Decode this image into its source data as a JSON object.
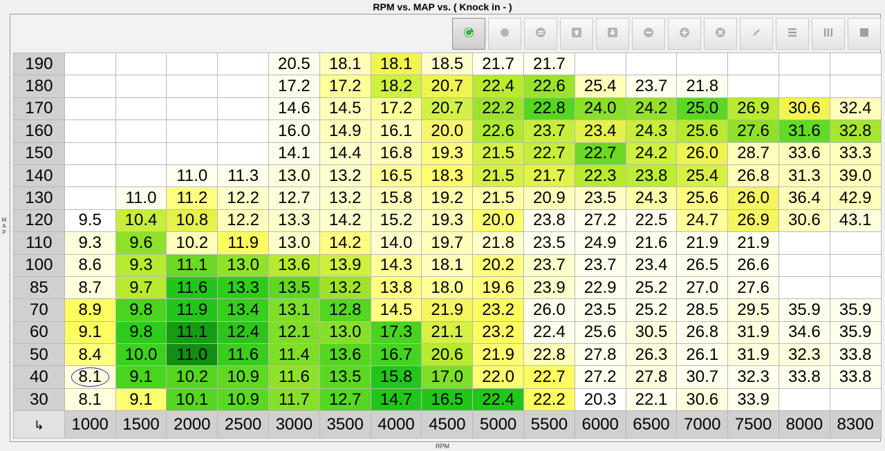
{
  "window": {
    "title": "RPM vs. MAP vs. ( Knock in -   )"
  },
  "axes": {
    "y_label": "MAP",
    "x_label": "RPM"
  },
  "toolbar": {
    "buttons": [
      {
        "icon": "refresh-icon",
        "active": true
      },
      {
        "icon": "circle-icon"
      },
      {
        "icon": "equals-icon"
      },
      {
        "icon": "arrow-up-icon"
      },
      {
        "icon": "arrow-down-icon"
      },
      {
        "icon": "minus-icon"
      },
      {
        "icon": "plus-icon"
      },
      {
        "icon": "close-icon"
      },
      {
        "icon": "pencil-icon"
      },
      {
        "icon": "rows-icon"
      },
      {
        "icon": "columns-icon"
      },
      {
        "icon": "square-icon"
      }
    ]
  },
  "table": {
    "corner_glyph": "↳",
    "rpm": [
      "1000",
      "1500",
      "2000",
      "2500",
      "3000",
      "3500",
      "4000",
      "4500",
      "5000",
      "5500",
      "6000",
      "6500",
      "7000",
      "7500",
      "8000",
      "8300"
    ],
    "rows": [
      {
        "map": "190",
        "cells": [
          "",
          "",
          "",
          "",
          "20.5",
          "18.1",
          "18.1",
          "18.5",
          "21.7",
          "21.7",
          "",
          "",
          "",
          "",
          "",
          ""
        ]
      },
      {
        "map": "180",
        "cells": [
          "",
          "",
          "",
          "",
          "17.2",
          "17.2",
          "18.2",
          "20.7",
          "22.4",
          "22.6",
          "25.4",
          "23.7",
          "21.8",
          "",
          "",
          ""
        ]
      },
      {
        "map": "170",
        "cells": [
          "",
          "",
          "",
          "",
          "14.6",
          "14.5",
          "17.2",
          "20.7",
          "22.2",
          "22.8",
          "24.0",
          "24.2",
          "25.0",
          "26.9",
          "30.6",
          "32.4"
        ]
      },
      {
        "map": "160",
        "cells": [
          "",
          "",
          "",
          "",
          "16.0",
          "14.9",
          "16.1",
          "20.0",
          "22.6",
          "23.7",
          "23.4",
          "24.3",
          "25.6",
          "27.6",
          "31.6",
          "32.8"
        ]
      },
      {
        "map": "150",
        "cells": [
          "",
          "",
          "",
          "",
          "14.1",
          "14.4",
          "16.8",
          "19.3",
          "21.5",
          "22.7",
          "22.7",
          "24.2",
          "26.0",
          "28.7",
          "33.6",
          "33.3"
        ]
      },
      {
        "map": "140",
        "cells": [
          "",
          "",
          "11.0",
          "11.3",
          "13.0",
          "13.2",
          "16.5",
          "18.3",
          "21.5",
          "21.7",
          "22.3",
          "23.8",
          "25.4",
          "26.8",
          "31.3",
          "39.0"
        ]
      },
      {
        "map": "130",
        "cells": [
          "",
          "11.0",
          "11.2",
          "12.2",
          "12.7",
          "13.2",
          "15.8",
          "19.2",
          "21.5",
          "20.9",
          "23.5",
          "24.3",
          "25.6",
          "26.0",
          "36.4",
          "42.9"
        ]
      },
      {
        "map": "120",
        "cells": [
          "9.5",
          "10.4",
          "10.8",
          "12.2",
          "13.3",
          "14.2",
          "15.2",
          "19.3",
          "20.0",
          "23.8",
          "27.2",
          "22.5",
          "24.7",
          "26.9",
          "30.6",
          "43.1"
        ]
      },
      {
        "map": "110",
        "cells": [
          "9.3",
          "9.6",
          "10.2",
          "11.9",
          "13.0",
          "14.2",
          "14.0",
          "19.7",
          "21.8",
          "23.5",
          "24.9",
          "21.6",
          "21.9",
          "21.9",
          "",
          ""
        ]
      },
      {
        "map": "100",
        "cells": [
          "8.6",
          "9.3",
          "11.1",
          "13.0",
          "13.6",
          "13.9",
          "14.3",
          "18.1",
          "20.2",
          "23.7",
          "23.7",
          "23.4",
          "26.5",
          "26.6",
          "",
          ""
        ]
      },
      {
        "map": "85",
        "cells": [
          "8.7",
          "9.7",
          "11.6",
          "13.3",
          "13.5",
          "13.2",
          "13.8",
          "18.0",
          "19.6",
          "23.9",
          "22.9",
          "25.2",
          "27.0",
          "27.6",
          "",
          ""
        ]
      },
      {
        "map": "70",
        "cells": [
          "8.9",
          "9.8",
          "11.9",
          "13.4",
          "13.1",
          "12.8",
          "14.5",
          "21.9",
          "23.2",
          "26.0",
          "23.5",
          "25.2",
          "28.5",
          "29.5",
          "35.9",
          "35.9"
        ]
      },
      {
        "map": "60",
        "cells": [
          "9.1",
          "9.8",
          "11.1",
          "12.4",
          "12.1",
          "13.0",
          "17.3",
          "21.1",
          "23.2",
          "22.4",
          "25.6",
          "30.5",
          "26.8",
          "31.9",
          "34.6",
          "35.9"
        ]
      },
      {
        "map": "50",
        "cells": [
          "8.4",
          "10.0",
          "11.0",
          "11.6",
          "11.4",
          "13.6",
          "16.7",
          "20.6",
          "21.9",
          "22.8",
          "27.8",
          "26.3",
          "26.1",
          "31.9",
          "32.3",
          "33.8"
        ]
      },
      {
        "map": "40",
        "cells": [
          "8.1",
          "9.1",
          "10.2",
          "10.9",
          "11.6",
          "13.5",
          "15.8",
          "17.0",
          "22.0",
          "22.7",
          "27.2",
          "27.8",
          "30.7",
          "32.3",
          "33.8",
          "33.8"
        ]
      },
      {
        "map": "30",
        "cells": [
          "8.1",
          "9.1",
          "10.1",
          "10.9",
          "11.7",
          "12.7",
          "14.7",
          "16.5",
          "22.4",
          "22.2",
          "20.3",
          "22.1",
          "30.6",
          "33.9",
          "",
          ""
        ]
      }
    ],
    "colors": [
      [
        "#ffffff",
        "#ffffff",
        "#ffffff",
        "#ffffff",
        "#ffffee",
        "#ffffbb",
        "#f0f550",
        "#ffffcc",
        "#ffffee",
        "#ffffee",
        "#ffffff",
        "#ffffff",
        "#ffffff",
        "#ffffff",
        "#ffffff",
        "#ffffff"
      ],
      [
        "#ffffff",
        "#ffffff",
        "#ffffff",
        "#ffffff",
        "#ffffee",
        "#ffff99",
        "#cef040",
        "#eef550",
        "#b8ea30",
        "#9be22a",
        "#ffffbb",
        "#ffffee",
        "#ffffee",
        "#ffffff",
        "#ffffff",
        "#ffffff"
      ],
      [
        "#ffffff",
        "#ffffff",
        "#ffffff",
        "#ffffff",
        "#ffffee",
        "#ffffbb",
        "#ffff99",
        "#d2f045",
        "#9fe22c",
        "#55d620",
        "#88e028",
        "#95e02a",
        "#5ad822",
        "#b8ea30",
        "#f2f550",
        "#ffffbb"
      ],
      [
        "#ffffff",
        "#ffffff",
        "#ffffff",
        "#ffffff",
        "#ffffee",
        "#ffffbb",
        "#ffffbb",
        "#f7f570",
        "#b0ea30",
        "#c6ee3a",
        "#e2f24a",
        "#c6ee3a",
        "#b8ea30",
        "#90e02a",
        "#65da24",
        "#a5e62e"
      ],
      [
        "#ffffff",
        "#ffffff",
        "#ffffff",
        "#ffffff",
        "#ffffee",
        "#ffffcc",
        "#ffffbb",
        "#fdfd80",
        "#d6f045",
        "#c6ee3a",
        "#6ad824",
        "#cef040",
        "#eef550",
        "#ffffbb",
        "#ffffbb",
        "#ffffbb"
      ],
      [
        "#ffffff",
        "#ffffff",
        "#ffffee",
        "#ffffee",
        "#ffffdd",
        "#ffffcc",
        "#ffff99",
        "#fdfd70",
        "#d6f045",
        "#e2f24a",
        "#b8ea30",
        "#bcec34",
        "#d6f045",
        "#ffffbb",
        "#ffffbb",
        "#ffffbb"
      ],
      [
        "#ffffff",
        "#ffffee",
        "#ffff80",
        "#ffffcc",
        "#ffffdd",
        "#ffffcc",
        "#ffffbb",
        "#ffffaa",
        "#ffffaa",
        "#ffffbb",
        "#ffffcc",
        "#ffffaa",
        "#fdfd80",
        "#f5f560",
        "#ffffbb",
        "#ffffbb"
      ],
      [
        "#ffffff",
        "#c6ee3a",
        "#e6f24a",
        "#ffffbb",
        "#ffffcc",
        "#ffffcc",
        "#ffffcc",
        "#ffffbb",
        "#fdfd70",
        "#ffffee",
        "#ffffee",
        "#ffffee",
        "#ffff99",
        "#f5f560",
        "#ffffbb",
        "#ffffdd"
      ],
      [
        "#ffffdd",
        "#90e02a",
        "#ffffbb",
        "#fdfd60",
        "#ffffcc",
        "#fdfd80",
        "#ffffcc",
        "#ffffbb",
        "#ffffcc",
        "#ffffee",
        "#ffffee",
        "#ffffee",
        "#ffffee",
        "#ffffee",
        "#ffffff",
        "#ffffff"
      ],
      [
        "#ffffdd",
        "#b8ea30",
        "#6ad824",
        "#8ee22a",
        "#b8ea30",
        "#cef040",
        "#ffff99",
        "#ffffbb",
        "#fdfd80",
        "#ffffcc",
        "#ffffee",
        "#ffffee",
        "#ffffee",
        "#ffffee",
        "#ffffff",
        "#ffffff"
      ],
      [
        "#ffffdd",
        "#b8ea30",
        "#22c61a",
        "#30cc1c",
        "#60d822",
        "#9fe22c",
        "#ffff80",
        "#ffff99",
        "#ffff80",
        "#ffffcc",
        "#ffffee",
        "#ffffee",
        "#ffffee",
        "#ffffee",
        "#ffffff",
        "#ffffff"
      ],
      [
        "#fdfd60",
        "#4ad420",
        "#22c61a",
        "#38ce1e",
        "#7ede28",
        "#55d620",
        "#ffff80",
        "#f5f560",
        "#fdfd60",
        "#ffffee",
        "#ffffee",
        "#ffffee",
        "#ffffee",
        "#ffffdd",
        "#ffffee",
        "#ffffee"
      ],
      [
        "#fdfd60",
        "#2ccc1c",
        "#159c12",
        "#2ec41c",
        "#7ede28",
        "#86e02a",
        "#45d420",
        "#d6f045",
        "#fdfd60",
        "#ffffee",
        "#ffffee",
        "#ffffdd",
        "#ffffee",
        "#ffffdd",
        "#ffffee",
        "#ffffee"
      ],
      [
        "#ffff80",
        "#3cd020",
        "#128e10",
        "#3acc1e",
        "#7ede28",
        "#55d620",
        "#45d420",
        "#b8ea30",
        "#fdfd70",
        "#ffffbb",
        "#ffffee",
        "#ffffdd",
        "#ffffee",
        "#ffffdd",
        "#ffffdd",
        "#ffffee"
      ],
      [
        "#ffffdd",
        "#4ad420",
        "#55d620",
        "#60d822",
        "#8ee22a",
        "#5ad822",
        "#22c61a",
        "#7ede28",
        "#fdfd70",
        "#fdfd60",
        "#ffffee",
        "#ffffdd",
        "#ffffee",
        "#ffffee",
        "#ffffee",
        "#ffffee"
      ],
      [
        "#ffffdd",
        "#fdfd70",
        "#55d620",
        "#5ad822",
        "#86e02a",
        "#55d620",
        "#22c61a",
        "#22c61a",
        "#22c61a",
        "#fdfd60",
        "#ffffff",
        "#ffffee",
        "#ffffdd",
        "#ffffee",
        "#ffffff",
        "#ffffff"
      ]
    ],
    "circled_cell": {
      "row": 14,
      "col": 0
    }
  }
}
